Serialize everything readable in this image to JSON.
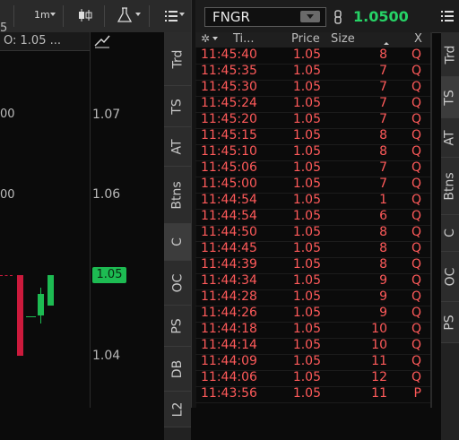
{
  "chart": {
    "toolbar": {
      "timeframe": "1m"
    },
    "ohlc_text": "O: 1.05 ...",
    "axis_labels": [
      "1.07",
      "1.06",
      "1.05",
      "1.04"
    ],
    "last_price_tag": "1.05",
    "left_value_fragments": [
      "5",
      "00",
      "00"
    ],
    "colors": {
      "up": "#1dbb52",
      "down": "#cc1a3c"
    }
  },
  "chart_tabs": [
    "Trd",
    "TS",
    "AT",
    "Btns",
    "C",
    "OC",
    "PS",
    "DB",
    "L2"
  ],
  "time_sales": {
    "symbol": "FNGR",
    "last_price": "1.0500",
    "columns": {
      "time": "Ti...",
      "price": "Price",
      "size": "Size",
      "exchange": "X"
    },
    "rows": [
      {
        "time": "11:45:40",
        "price": "1.05",
        "size": "8",
        "x": "Q"
      },
      {
        "time": "11:45:35",
        "price": "1.05",
        "size": "7",
        "x": "Q"
      },
      {
        "time": "11:45:30",
        "price": "1.05",
        "size": "7",
        "x": "Q"
      },
      {
        "time": "11:45:24",
        "price": "1.05",
        "size": "7",
        "x": "Q"
      },
      {
        "time": "11:45:20",
        "price": "1.05",
        "size": "7",
        "x": "Q"
      },
      {
        "time": "11:45:15",
        "price": "1.05",
        "size": "8",
        "x": "Q"
      },
      {
        "time": "11:45:10",
        "price": "1.05",
        "size": "8",
        "x": "Q"
      },
      {
        "time": "11:45:06",
        "price": "1.05",
        "size": "7",
        "x": "Q"
      },
      {
        "time": "11:45:00",
        "price": "1.05",
        "size": "7",
        "x": "Q"
      },
      {
        "time": "11:44:54",
        "price": "1.05",
        "size": "1",
        "x": "Q"
      },
      {
        "time": "11:44:54",
        "price": "1.05",
        "size": "6",
        "x": "Q"
      },
      {
        "time": "11:44:50",
        "price": "1.05",
        "size": "8",
        "x": "Q"
      },
      {
        "time": "11:44:45",
        "price": "1.05",
        "size": "8",
        "x": "Q"
      },
      {
        "time": "11:44:39",
        "price": "1.05",
        "size": "8",
        "x": "Q"
      },
      {
        "time": "11:44:34",
        "price": "1.05",
        "size": "9",
        "x": "Q"
      },
      {
        "time": "11:44:28",
        "price": "1.05",
        "size": "9",
        "x": "Q"
      },
      {
        "time": "11:44:26",
        "price": "1.05",
        "size": "9",
        "x": "Q"
      },
      {
        "time": "11:44:18",
        "price": "1.05",
        "size": "10",
        "x": "Q"
      },
      {
        "time": "11:44:14",
        "price": "1.05",
        "size": "10",
        "x": "Q"
      },
      {
        "time": "11:44:09",
        "price": "1.05",
        "size": "11",
        "x": "Q"
      },
      {
        "time": "11:44:06",
        "price": "1.05",
        "size": "12",
        "x": "Q"
      },
      {
        "time": "11:43:56",
        "price": "1.05",
        "size": "11",
        "x": "P"
      }
    ]
  },
  "ts_tabs": [
    "Trd",
    "TS",
    "AT",
    "Btns",
    "C",
    "OC",
    "PS"
  ],
  "colors": {
    "trade_red": "#ff5a5a",
    "last_green": "#26d366"
  }
}
